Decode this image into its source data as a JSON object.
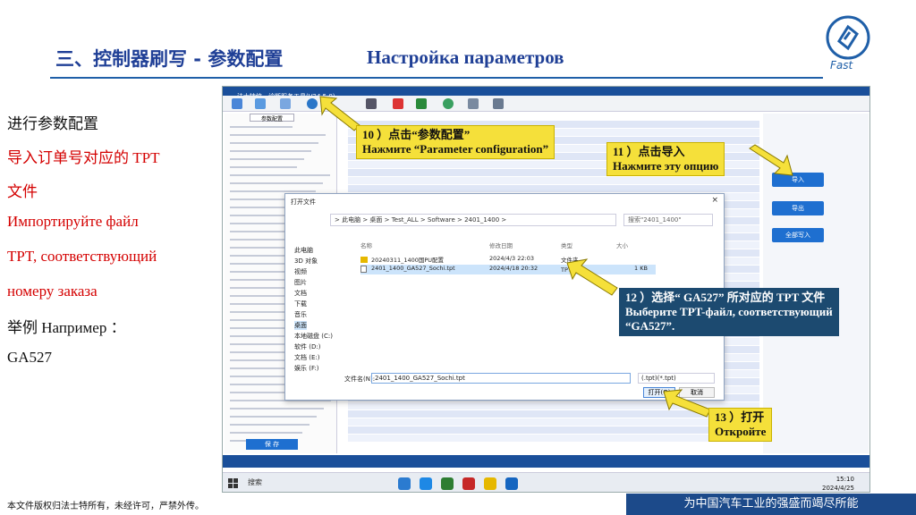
{
  "header": {
    "title_cn": "三、控制器刷写 -  参数配置",
    "title_ru": "Настройка параметров",
    "logo_text": "Fast"
  },
  "left_text": {
    "line1": "进行参数配置",
    "line2": "导入订单号对应的 TPT",
    "line3": "文件",
    "line4": "Импортируйте файл",
    "line5": "TPT, соответствующий",
    "line6": "номеру заказа",
    "line7": "举例 Например ：",
    "line8": "GA527"
  },
  "app": {
    "window_title": "法士特统一诊断服务工具(V24.5.0)",
    "tab_label": "参数配置",
    "right_buttons": [
      "导入",
      "导出",
      "全部写入"
    ],
    "bottom_left_button": "保  存"
  },
  "dialog": {
    "title": "打开文件",
    "close": "×",
    "path": "> 此电脑 > 桌面 > Test_ALL > Software > 2401_1400 >",
    "search_placeholder": "搜索\"2401_1400\"",
    "sidebar": [
      "此电脑",
      "3D 对象",
      "视频",
      "图片",
      "文档",
      "下载",
      "音乐",
      "桌面",
      "本地磁盘 (C:)",
      "软件 (D:)",
      "文档 (E:)",
      "娱乐 (F:)"
    ],
    "columns": [
      "名称",
      "修改日期",
      "类型",
      "大小"
    ],
    "files": [
      {
        "name": "20240311_1400国PU配置",
        "date": "2024/4/3 22:03",
        "type": "文件夹",
        "size": ""
      },
      {
        "name": "2401_1400_GA527_Sochi.tpt",
        "date": "2024/4/18 20:32",
        "type": "TPT 文件",
        "size": "1 KB"
      }
    ],
    "filename_label": "文件名(N):",
    "filename_value": "2401_1400_GA527_Sochi.tpt",
    "filter": "(.tpt)(*.tpt)",
    "open_button": "打开(O)",
    "cancel_button": "取消"
  },
  "taskbar": {
    "search": "搜索",
    "time": "15:10",
    "date": "2024/4/25"
  },
  "callouts": {
    "c10_cn": "10 ）点击“参数配置”",
    "c10_ru": "Нажмите “Parameter configuration”",
    "c11_cn": "11 ）点击导入",
    "c11_ru": "Нажмите эту опцию",
    "c12_cn": "12 ）选择“ GA527” 所对应的 TPT 文件",
    "c12_ru1": "Выберите TPT-файл, соответствующий",
    "c12_ru2": "“GA527”.",
    "c13_cn": "13 ）打开",
    "c13_ru": "Откройте"
  },
  "footer": {
    "left": "本文件版权归法士特所有，未经许可，严禁外传。",
    "right": "为中国汽车工业的强盛而竭尽所能"
  },
  "colors": {
    "accent": "#1f3f96",
    "red": "#d40000",
    "callout_yellow": "#f5e03a",
    "callout_dark": "#1c4a70",
    "app_blue": "#1a4f9a"
  }
}
